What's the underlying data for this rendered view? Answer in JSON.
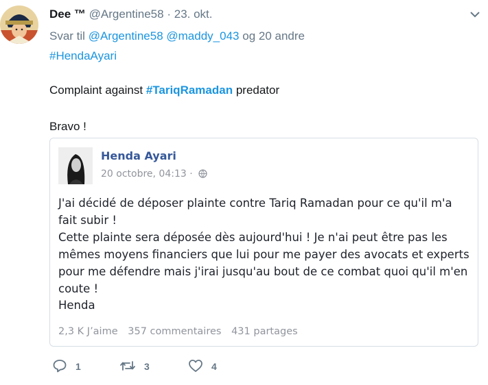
{
  "tweet": {
    "author_name": "Dee ™",
    "handle": "@Argentine58",
    "separator": "·",
    "date": "23. okt.",
    "reply_prefix": "Svar til",
    "reply_user1": "@Argentine58",
    "reply_user2": "@maddy_043",
    "reply_suffix": "og 20 andre",
    "hashtag": "#HendaAyari",
    "text_before": "Complaint against",
    "text_hashtag": "#TariqRamadan",
    "text_after": "predator",
    "text_bravo": "Bravo !"
  },
  "embedded_post": {
    "name": "Henda Ayari",
    "date": "20 octobre, 04:13",
    "separator": "·",
    "body_line1": "J'ai décidé de déposer plainte contre Tariq Ramadan pour ce qu'il m'a fait subir !",
    "body_line2": "Cette plainte sera déposée dès aujourd'hui ! Je n'ai peut être pas les mêmes moyens financiers que lui pour me payer des avocats et experts pour me défendre mais j'irai jusqu'au bout de ce combat quoi qu'il m'en coute !",
    "signature": "Henda",
    "likes": "2,3 K J’aime",
    "comments": "357 commentaires",
    "shares": "431 partages"
  },
  "actions": {
    "reply_count": "1",
    "retweet_count": "3",
    "like_count": "4"
  },
  "colors": {
    "link": "#1b95e0",
    "muted": "#657786",
    "fb_name": "#365899",
    "fb_muted": "#90949c"
  },
  "icons": [
    "chevron-down-icon",
    "globe-icon",
    "reply-icon",
    "retweet-icon",
    "heart-icon"
  ]
}
